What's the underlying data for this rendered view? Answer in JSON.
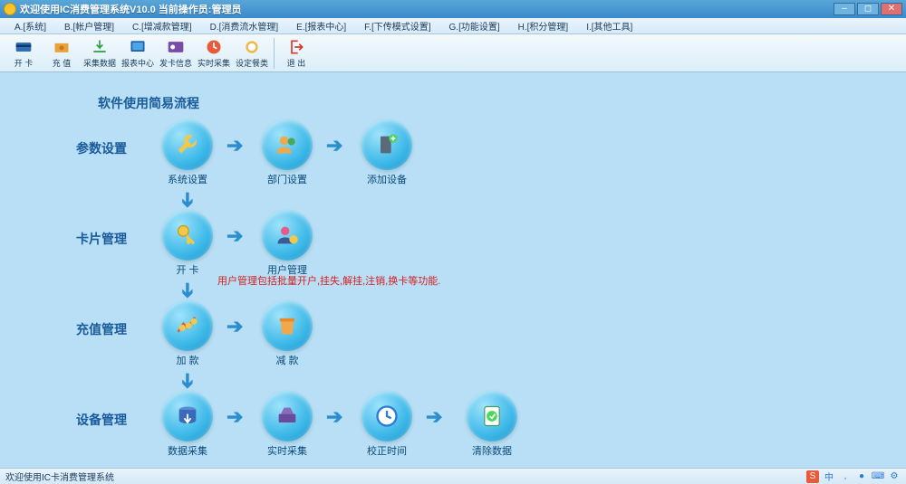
{
  "titlebar": {
    "text": "欢迎使用IC消费管理系统V10.0 当前操作员:管理员"
  },
  "menubar": {
    "items": [
      "A.[系统]",
      "B.[帐户管理]",
      "C.[增减款管理]",
      "D.[消费流水管理]",
      "E.[报表中心]",
      "F.[下传模式设置]",
      "G.[功能设置]",
      "H.[积分管理]",
      "I.[其他工具]"
    ]
  },
  "toolbar": {
    "items": [
      "开 卡",
      "充 值",
      "采集数据",
      "报表中心",
      "发卡信息",
      "实时采集",
      "设定餐类",
      "退 出"
    ]
  },
  "flow": {
    "title": "软件使用简易流程",
    "sections": {
      "params": "参数设置",
      "card": "卡片管理",
      "recharge": "充值管理",
      "device": "设备管理"
    },
    "nodes": {
      "sys_set": "系统设置",
      "dept_set": "部门设置",
      "add_dev": "添加设备",
      "open_card": "开 卡",
      "user_mgmt": "用户管理",
      "add_money": "加 款",
      "sub_money": "减 款",
      "data_collect": "数据采集",
      "realtime": "实时采集",
      "cal_time": "校正时间",
      "clear_data": "清除数据"
    },
    "note": "用户管理包括批量开户,挂失,解挂,注销,换卡等功能."
  },
  "statusbar": {
    "text": "欢迎使用IC卡消费管理系统"
  }
}
